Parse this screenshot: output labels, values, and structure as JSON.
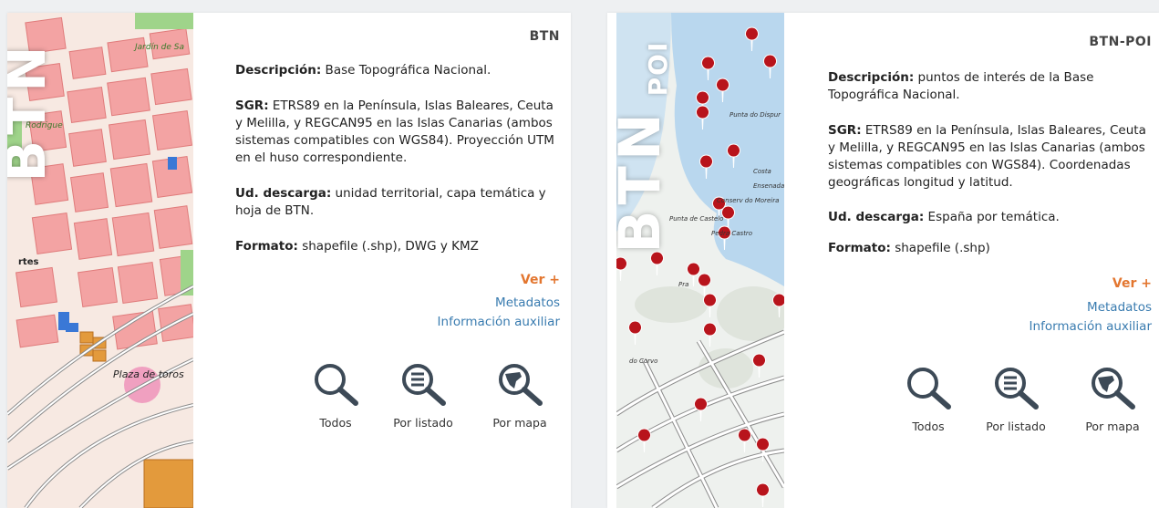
{
  "cards": [
    {
      "code": "BTN",
      "thumb_text": "BTN",
      "map_labels": [
        "Jardín de Sa",
        "Rodrigue",
        "rtes",
        "Plaza de toros"
      ],
      "desc_label": "Descripción:",
      "desc_text": " Base Topográfica Nacional.",
      "sgr_label": "SGR:",
      "sgr_text": " ETRS89 en la Península, Islas Baleares, Ceuta y Melilla, y REGCAN95 en las Islas Canarias (ambos sistemas compatibles con WGS84). Proyección UTM en el huso correspondiente.",
      "ud_label": "Ud. descarga:",
      "ud_text": " unidad territorial, capa temática y hoja de BTN.",
      "formato_label": "Formato:",
      "formato_text": " shapefile (.shp), DWG y KMZ",
      "ver_mas": "Ver +",
      "metadatos": "Metadatos",
      "info_aux": "Información auxiliar",
      "buttons": [
        "Todos",
        "Por listado",
        "Por mapa"
      ]
    },
    {
      "code": "BTN-POI",
      "thumb_text": "BTN",
      "thumb_sub": "POI",
      "map_labels": [
        "Punta do Dispur",
        "Costa",
        "Ensenada",
        "Conserv do Moreira",
        "Punta de Castelo",
        "Pedra Castro",
        "Pra",
        "do Corvo"
      ],
      "desc_label": "Descripción:",
      "desc_text": " puntos de interés de la Base Topográfica Nacional.",
      "sgr_label": "SGR:",
      "sgr_text": " ETRS89 en la Península, Islas Baleares, Ceuta y Melilla, y REGCAN95 en las Islas Canarias (ambos sistemas compatibles con WGS84). Coordenadas geográficas longitud y latitud.",
      "ud_label": "Ud. descarga:",
      "ud_text": " España por temática.",
      "formato_label": "Formato:",
      "formato_text": " shapefile (.shp)",
      "ver_mas": "Ver +",
      "metadatos": "Metadatos",
      "info_aux": "Información auxiliar",
      "buttons": [
        "Todos",
        "Por listado",
        "Por mapa"
      ]
    }
  ],
  "colors": {
    "accent_orange": "#e3762f",
    "link_blue": "#3a7cb0",
    "icon_dark": "#3d4a57",
    "map_block_red": "#f3a3a3",
    "map_sea_blue": "#b9d7ee",
    "poi_marker": "#b8141c"
  },
  "icons": [
    "search-icon",
    "list-search-icon",
    "map-search-icon"
  ]
}
